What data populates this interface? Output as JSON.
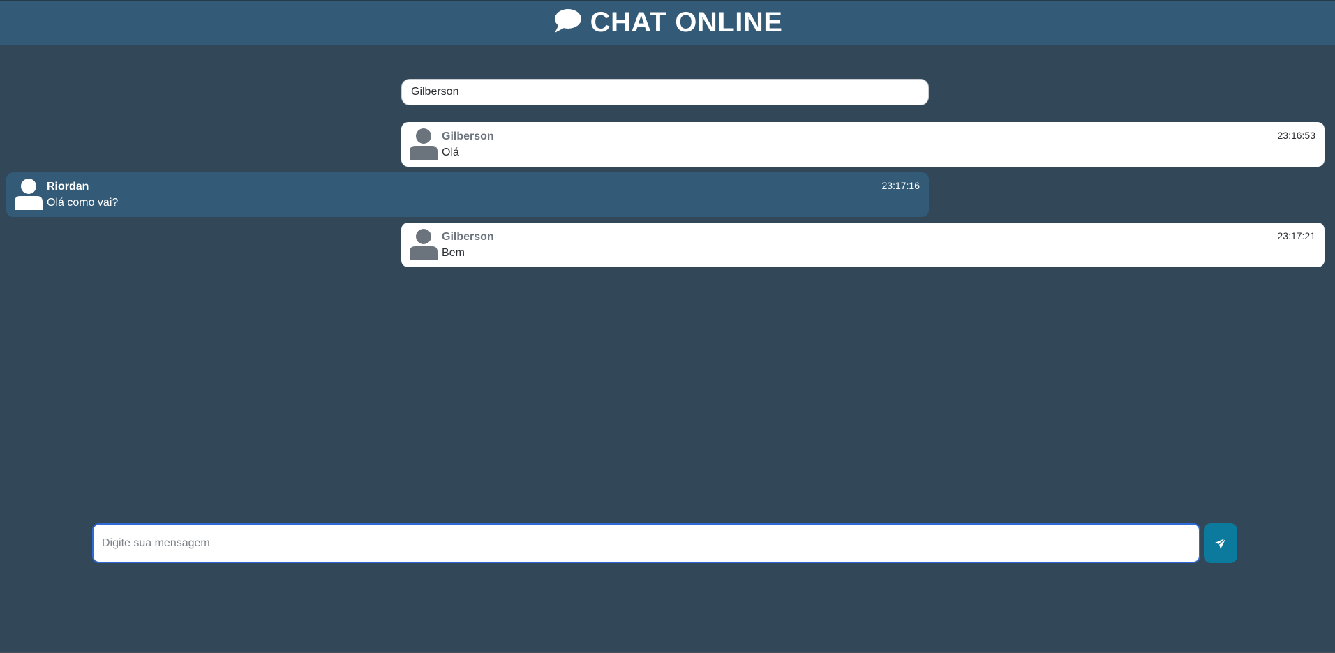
{
  "header": {
    "icon": "chat-bubble-icon",
    "title": "CHAT ONLINE"
  },
  "name_field": {
    "value": "Gilberson"
  },
  "messages": [
    {
      "author": "Gilberson",
      "text": "Olá",
      "time": "23:16:53",
      "side": "other"
    },
    {
      "author": "Riordan",
      "text": "Olá como vai?",
      "time": "23:17:16",
      "side": "mine"
    },
    {
      "author": "Gilberson",
      "text": "Bem",
      "time": "23:17:21",
      "side": "other"
    }
  ],
  "composer": {
    "placeholder": "Digite sua mensagem",
    "send_icon": "paper-plane-icon"
  },
  "colors": {
    "background": "#324859",
    "header": "#335a77",
    "own_message": "#335a77",
    "other_message": "#ffffff",
    "send_button": "#0c7a9c"
  }
}
